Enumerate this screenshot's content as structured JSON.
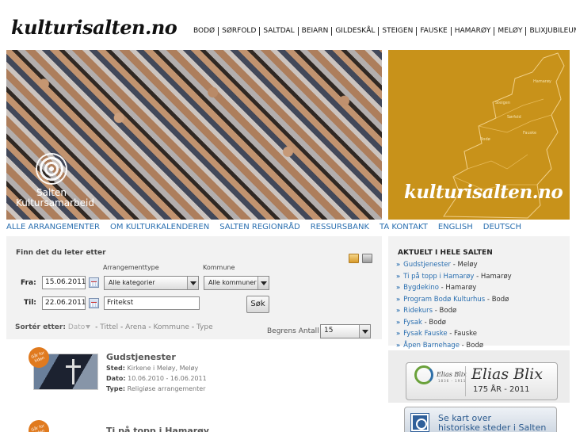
{
  "brand": "kulturisalten.no",
  "topnav": [
    "BODØ",
    "SØRFOLD",
    "SALTDAL",
    "BEIARN",
    "GILDESKÅL",
    "STEIGEN",
    "FAUSKE",
    "HAMARØY",
    "MELØY",
    "BLIXJUBILEUM"
  ],
  "hero": {
    "salten_logo_line1": "Salten",
    "salten_logo_line2": "Kultursamarbeid",
    "map_brand": "kulturisalten.no",
    "map_labels": [
      "Hamarøy",
      "Sørfold",
      "Steigen",
      "Bodø",
      "Fauske"
    ]
  },
  "subnav": [
    "ALLE ARRANGEMENTER",
    "OM KULTURKALENDEREN",
    "SALTEN REGIONRÅD",
    "RESSURSBANK",
    "TA KONTAKT",
    "ENGLISH",
    "DEUTSCH"
  ],
  "search": {
    "title": "Finn det du leter etter",
    "from_label": "Fra:",
    "to_label": "Til:",
    "from_value": "15.06.2011",
    "to_value": "22.06.2011",
    "category_label": "Arrangementtype",
    "category_value": "Alle kategorier",
    "municipality_label": "Kommune",
    "municipality_value": "Alle kommuner",
    "freetext_value": "Fritekst",
    "search_button": "Søk"
  },
  "sort": {
    "label": "Sortér etter:",
    "options": [
      "Dato",
      "Tittel",
      "Arena",
      "Kommune",
      "Type"
    ],
    "limit_label": "Begrens Antall",
    "limit_value": "15"
  },
  "events": [
    {
      "badge": "Går for tiden",
      "title": "Gudstjenester",
      "sted_label": "Sted:",
      "sted": "Kirkene i Meløy, Meløy",
      "dato_label": "Dato:",
      "dato": "10.06.2010 - 16.06.2011",
      "type_label": "Type:",
      "type": "Religiøse arrangementer"
    },
    {
      "badge": "Går for tiden",
      "title": "Ti på topp i Hamarøy"
    }
  ],
  "aktuelt": {
    "title": "AKTUELT I HELE SALTEN",
    "items": [
      {
        "link": "Gudstjenester",
        "place": "Meløy"
      },
      {
        "link": "Ti på topp i Hamarøy",
        "place": "Hamarøy"
      },
      {
        "link": "Bygdekino",
        "place": "Hamarøy"
      },
      {
        "link": "Program Bodø Kulturhus",
        "place": "Bodø"
      },
      {
        "link": "Ridekurs",
        "place": "Bodø"
      },
      {
        "link": "Fysak",
        "place": "Bodø"
      },
      {
        "link": "Fysak Fauske",
        "place": "Fauske"
      },
      {
        "link": "Åpen Barnehage",
        "place": "Bodø"
      }
    ]
  },
  "blix": {
    "small_name": "Elias Blix",
    "small_sub": "1836 - 1911",
    "name": "Elias Blix",
    "years": "175 ÅR  - 2011"
  },
  "kart": {
    "line1": "Se kart over",
    "line2": "historiske steder i Salten"
  },
  "colors": {
    "link": "#2a6fb0",
    "map_bg": "#c8921a",
    "panel_bg": "#f2f2f2",
    "badge": "#e07a1e"
  }
}
